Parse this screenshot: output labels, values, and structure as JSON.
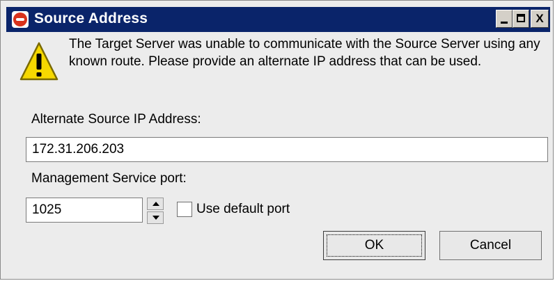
{
  "window": {
    "title": "Source Address",
    "controls": {
      "minimize": "minimize",
      "maximize": "maximize",
      "close": "X"
    }
  },
  "message": "The Target Server was unable to communicate with the Source Server using any known route. Please provide an alternate IP address that can be used.",
  "form": {
    "ip_label": "Alternate Source IP Address:",
    "ip_value": "172.31.206.203",
    "port_label": "Management Service port:",
    "port_value": "1025",
    "use_default_label": "Use default port",
    "use_default_checked": false
  },
  "buttons": {
    "ok": "OK",
    "cancel": "Cancel"
  },
  "icons": {
    "app": "app-icon",
    "warning": "warning-icon"
  },
  "colors": {
    "titlebar": "#0a246a",
    "warning_fill": "#f6d800"
  }
}
